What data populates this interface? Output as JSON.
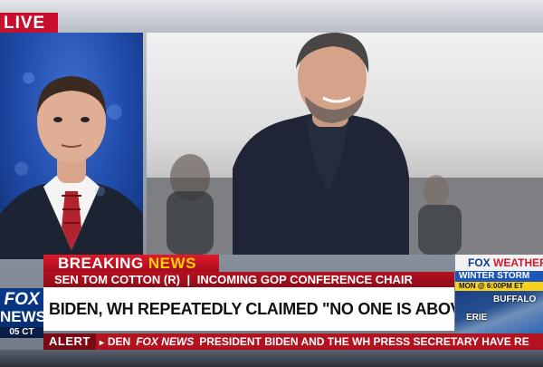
{
  "live": {
    "label": "LIVE"
  },
  "lower_third": {
    "breaking_word1": "BREAKING",
    "breaking_word2": "NEWS",
    "guest_name": "SEN TOM COTTON (R)",
    "separator": "|",
    "guest_title": "INCOMING GOP CONFERENCE CHAIR",
    "headline": "BIDEN, WH REPEATEDLY CLAIMED \"NO ONE IS ABOVE LAW\""
  },
  "network_logo": {
    "line1": "FOX",
    "line2": "NEWS",
    "time": "05 CT"
  },
  "weather": {
    "brand_fox": "FOX",
    "brand_weather": "WEATHER",
    "storm": "WINTER STORM",
    "time": "MON @ 6:00PM ET",
    "cities": [
      "BUFFALO",
      "ERIE"
    ]
  },
  "ticker": {
    "alert": "ALERT",
    "arrow": "▸",
    "lead": "DEN",
    "logo": "FOX NEWS",
    "text": "PRESIDENT BIDEN AND THE WH PRESS SECRETARY HAVE RE"
  },
  "colors": {
    "fox_red": "#b3121f",
    "fox_blue": "#0a3a8c",
    "breaking_yellow": "#ffd200"
  }
}
